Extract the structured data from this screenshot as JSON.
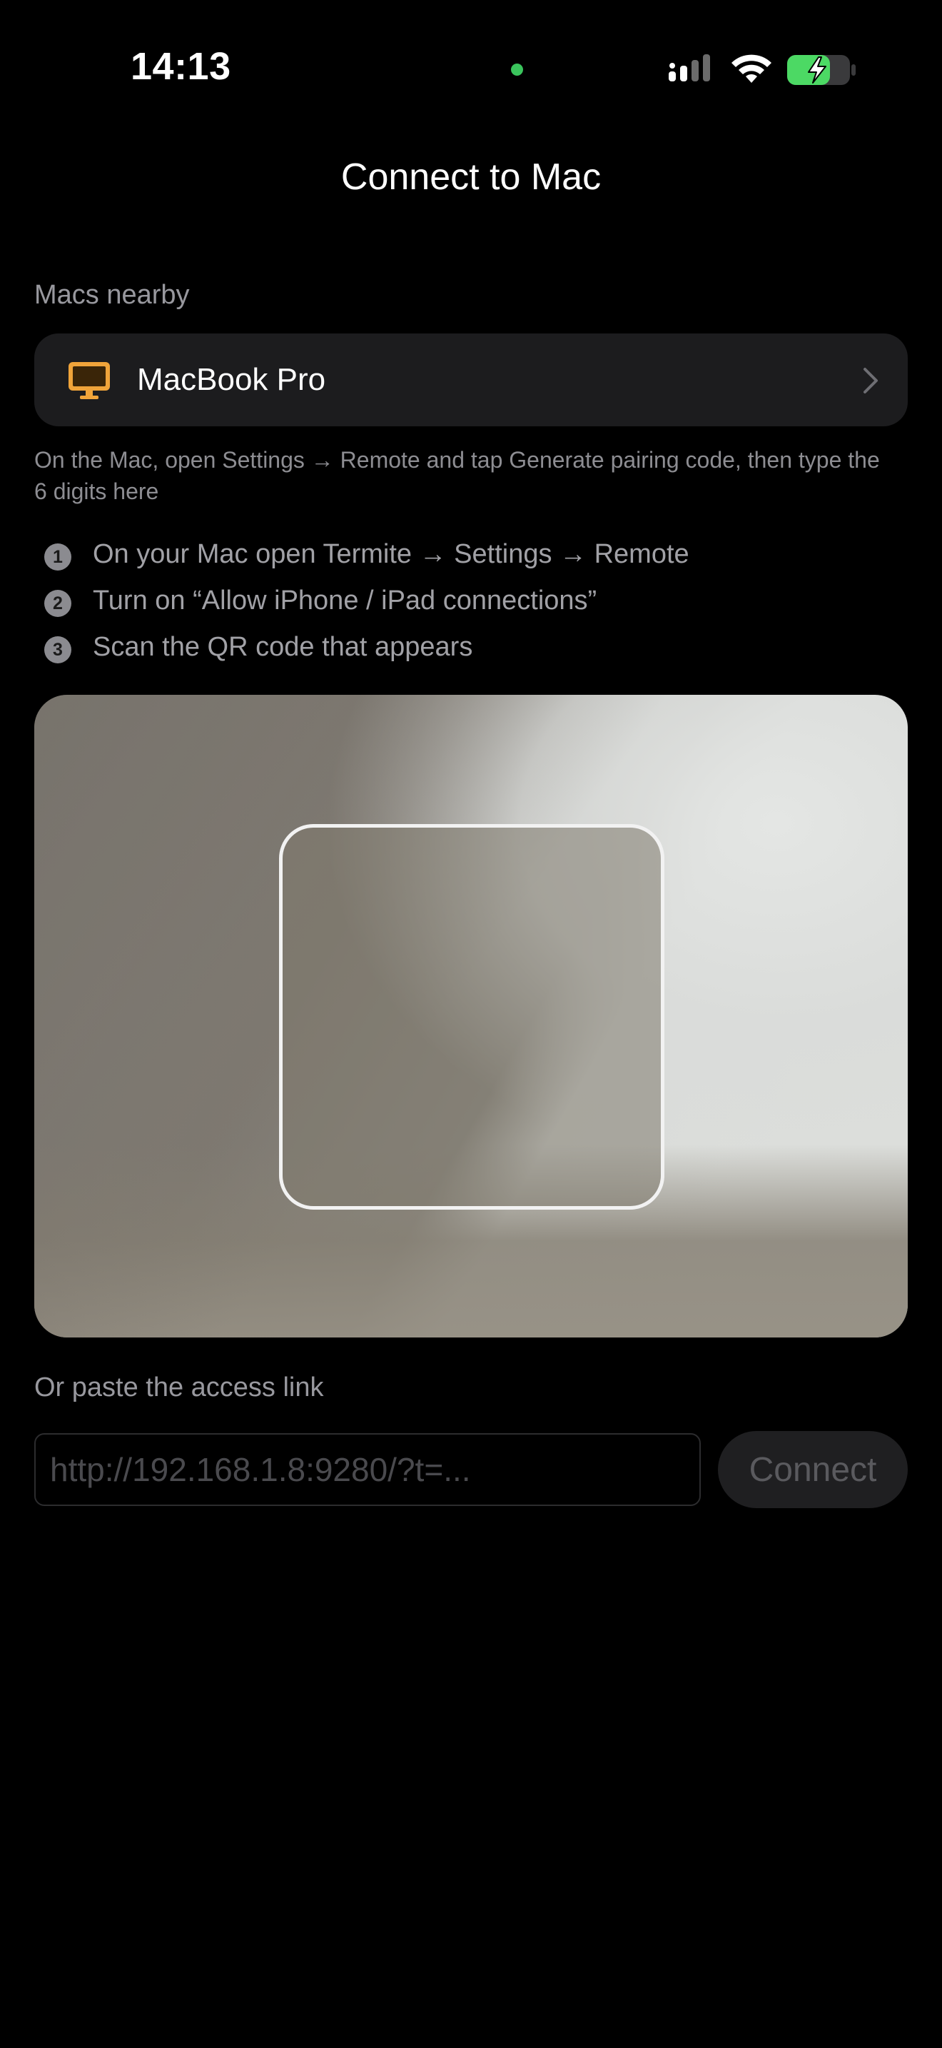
{
  "status_bar": {
    "time": "14:13"
  },
  "header": {
    "title": "Connect to Mac"
  },
  "nearby": {
    "section_label": "Macs nearby",
    "devices": [
      {
        "name": "MacBook Pro",
        "icon": "desktop-computer-icon"
      }
    ],
    "helper_text": "On the Mac, open Settings → Remote and tap Generate pairing code, then type the 6 digits here"
  },
  "steps": [
    {
      "number": "1",
      "text": "On your Mac open Termite → Settings → Remote"
    },
    {
      "number": "2",
      "text": "Turn on “Allow iPhone / iPad connections”"
    },
    {
      "number": "3",
      "text": "Scan the QR code that appears"
    }
  ],
  "paste": {
    "label": "Or paste the access link",
    "placeholder": "http://192.168.1.8:9280/?t=...",
    "value": "",
    "connect_label": "Connect"
  },
  "colors": {
    "background": "#000000",
    "card": "#1c1c1e",
    "mac_icon_accent": "#f0a43a",
    "battery_green": "#4cd964",
    "camera_dot": "#3ac45c"
  }
}
